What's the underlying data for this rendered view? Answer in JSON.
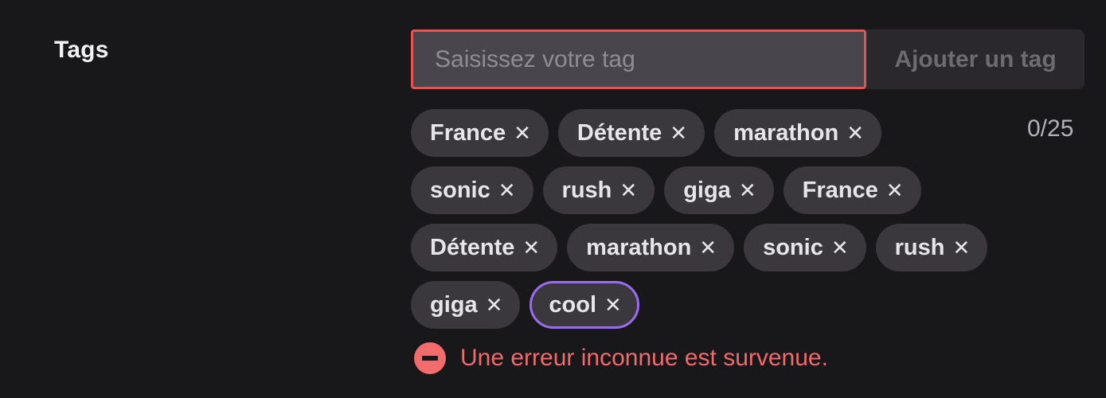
{
  "field": {
    "label": "Tags"
  },
  "input": {
    "value": "",
    "placeholder": "Saisissez votre tag"
  },
  "add_button_label": "Ajouter un tag",
  "counter": "0/25",
  "tags": [
    [
      "France",
      "Détente",
      "marathon"
    ],
    [
      "sonic",
      "rush",
      "giga",
      "France"
    ],
    [
      "Détente",
      "marathon",
      "sonic",
      "rush"
    ],
    [
      "giga",
      "cool"
    ]
  ],
  "remove_glyph": "✕",
  "selected_tag": "cool",
  "error": {
    "message": "Une erreur inconnue est survenue.",
    "icon": "minus-circle-icon"
  },
  "colors": {
    "input_error_border": "#ef4f4f",
    "selected_tag_border": "#9b6cf0",
    "error_text": "#f06b6b"
  }
}
